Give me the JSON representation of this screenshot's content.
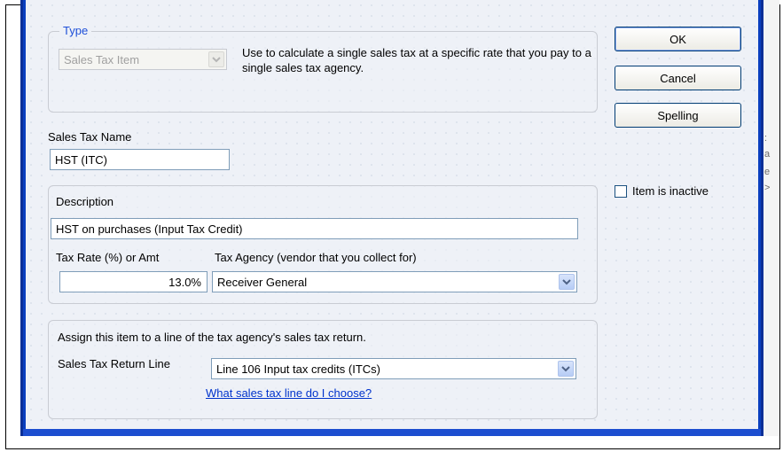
{
  "type_group": {
    "legend": "Type",
    "selected_type": "Sales Tax Item",
    "description": "Use to calculate a single sales tax at a specific rate that you pay to a single sales tax agency."
  },
  "buttons": {
    "ok": "OK",
    "cancel": "Cancel",
    "spelling": "Spelling"
  },
  "item_inactive": {
    "label": "Item is inactive",
    "checked": false
  },
  "sales_tax_name": {
    "label": "Sales Tax Name",
    "value": "HST (ITC)"
  },
  "description_group": {
    "label": "Description",
    "value": "HST on purchases (Input Tax Credit)",
    "tax_rate_label": "Tax Rate (%) or Amt",
    "tax_rate_value": "13.0%",
    "tax_agency_label": "Tax Agency (vendor that you collect for)",
    "tax_agency_value": "Receiver General"
  },
  "return_line_group": {
    "assign_label": "Assign this item to a line of the tax agency's sales tax return.",
    "return_line_label": "Sales Tax Return Line",
    "return_line_value": "Line 106 Input tax credits (ITCs)",
    "help_link": "What sales tax line do I choose?"
  },
  "gutter_chars": [
    ":",
    "a",
    "e",
    ">"
  ],
  "colors": {
    "window_frame": "#0a3fbf",
    "legend_text": "#1e4fd8",
    "link": "#0033cc",
    "dialog_bg": "#eef1f7"
  },
  "icons": {
    "dropdown": "chevron-down-icon"
  }
}
